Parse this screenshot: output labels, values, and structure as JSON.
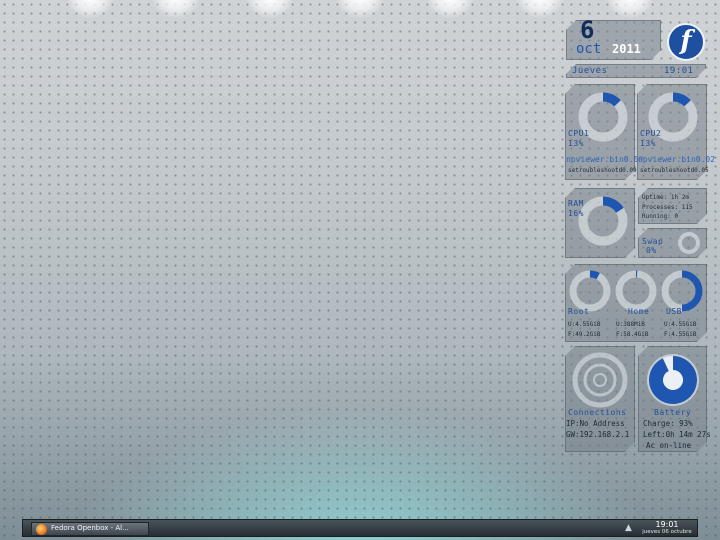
{
  "date": {
    "day": "6",
    "month": "oct",
    "year": "2011",
    "weekday": "Jueves",
    "time": "19:01"
  },
  "cpu1": {
    "label": "CPU1",
    "percent_text": "13%",
    "value": 13,
    "process": "npviewer.bin0.00",
    "process2": "setroubleshootd0.09"
  },
  "cpu2": {
    "label": "CPU2",
    "percent_text": "13%",
    "value": 13,
    "process": "npviewer.bin0.02",
    "process2": "setroubleshootd0.05"
  },
  "ram": {
    "label": "RAM",
    "percent_text": "16%",
    "value": 16
  },
  "system": {
    "uptime": "Uptime: 1h 2m",
    "processes": "Processes: 115",
    "running": "Running: 0"
  },
  "swap": {
    "label": "Swap",
    "percent_text": "0%",
    "value": 0
  },
  "disks": {
    "root": {
      "label": "Root",
      "used": "U:4.55GiB",
      "free": "F:49.2GiB",
      "value": 8
    },
    "home": {
      "label": "Home",
      "used": "U:388MiB",
      "free": "F:58.4GiB",
      "value": 1
    },
    "usb": {
      "label": "USB",
      "used": "U:4.55GiB",
      "free": "F:4.55GiB",
      "value": 50
    }
  },
  "connections": {
    "label": "Connections",
    "ip": "IP:No Address",
    "gw": "GW:192.168.2.1"
  },
  "battery": {
    "label": "Battery",
    "charge": "Charge:    93%",
    "left": "Left:0h 14m 27s",
    "ac": "Ac     on-line",
    "value": 93
  },
  "taskbar": {
    "task_label": "Fedora Openbox - Al...",
    "clock_time": "19:01",
    "clock_date": "jueves 06 octubre"
  },
  "colors": {
    "accent": "#1f56b0",
    "panel": "#7a848c",
    "taskbar": "#2c3338"
  }
}
